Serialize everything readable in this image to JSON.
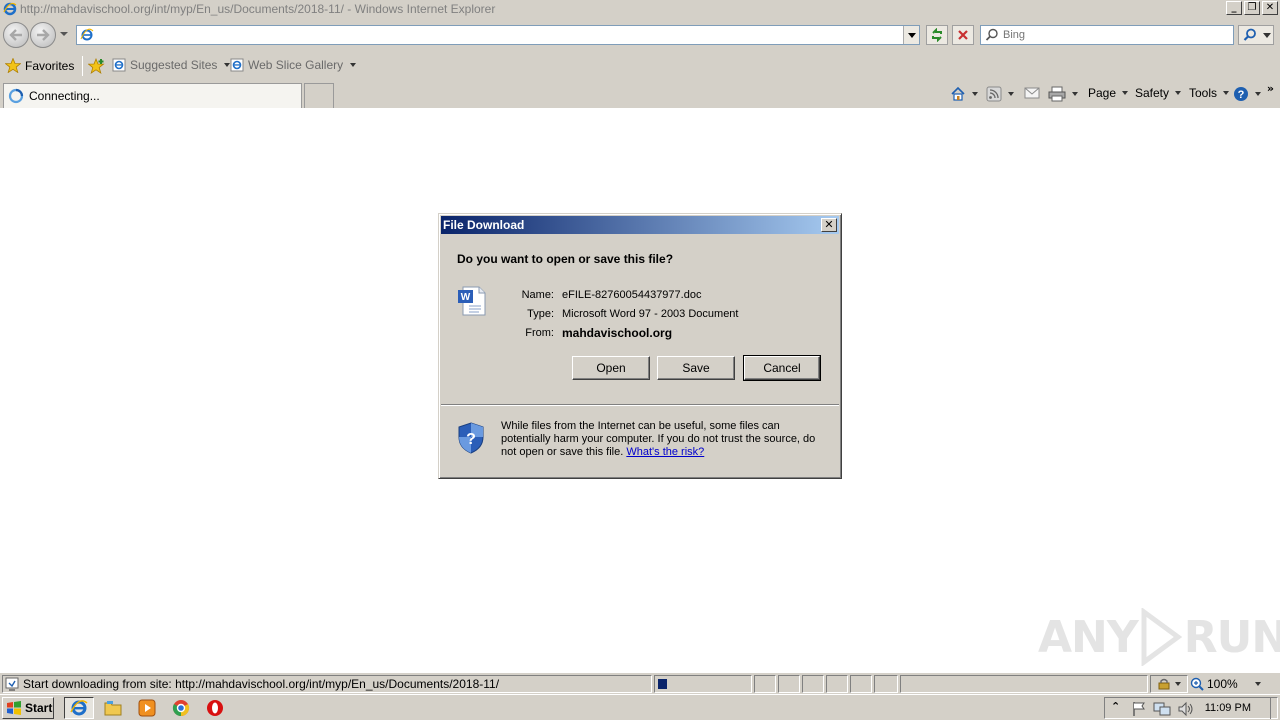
{
  "window": {
    "title": "http://mahdavischool.org/int/myp/En_us/Documents/2018-11/ - Windows Internet Explorer",
    "min_glyph": "_",
    "restore_glyph": "❐",
    "close_glyph": "✕"
  },
  "toolbar": {
    "address_value": "",
    "search_placeholder": "Bing"
  },
  "favorites": {
    "favorites_label": "Favorites",
    "suggested_sites_label": "Suggested Sites",
    "web_slice_label": "Web Slice Gallery"
  },
  "tab": {
    "label": "Connecting..."
  },
  "commands": {
    "page_label": "Page",
    "safety_label": "Safety",
    "tools_label": "Tools"
  },
  "dialog": {
    "title": "File Download",
    "question": "Do you want to open or save this file?",
    "name_key": "Name:",
    "name_value": "eFILE-82760054437977.doc",
    "type_key": "Type:",
    "type_value": "Microsoft Word 97 - 2003 Document",
    "from_key": "From:",
    "from_value": "mahdavischool.org",
    "open_label": "Open",
    "save_label": "Save",
    "cancel_label": "Cancel",
    "warning_text": "While files from the Internet can be useful, some files can potentially harm your computer. If you do not trust the source, do not open or save this file.",
    "risk_link": "What's the risk?"
  },
  "status": {
    "text": "Start downloading from site: http://mahdavischool.org/int/myp/En_us/Documents/2018-11/",
    "progress_fraction": 0.1,
    "zoom": "100%"
  },
  "taskbar": {
    "start_label": "Start",
    "clock": "11:09 PM"
  },
  "watermark": {
    "text_left": "ANY",
    "text_right": "RUN"
  },
  "colors": {
    "dialog_title_start": "#0a246a",
    "dialog_title_end": "#a6caf0",
    "chrome_face": "#d4d0c8",
    "link": "#0000cc"
  },
  "icons": [
    "ie-logo-icon",
    "back-icon",
    "forward-icon",
    "refresh-icon",
    "stop-icon",
    "search-icon",
    "favorites-star-icon",
    "add-favorites-icon",
    "home-icon",
    "feeds-icon",
    "mail-icon",
    "print-icon",
    "help-icon",
    "word-document-icon",
    "shield-icon",
    "windows-logo-icon",
    "chrome-icon",
    "media-player-icon",
    "folder-icon",
    "opera-icon",
    "flag-icon",
    "network-icon",
    "speaker-icon"
  ]
}
